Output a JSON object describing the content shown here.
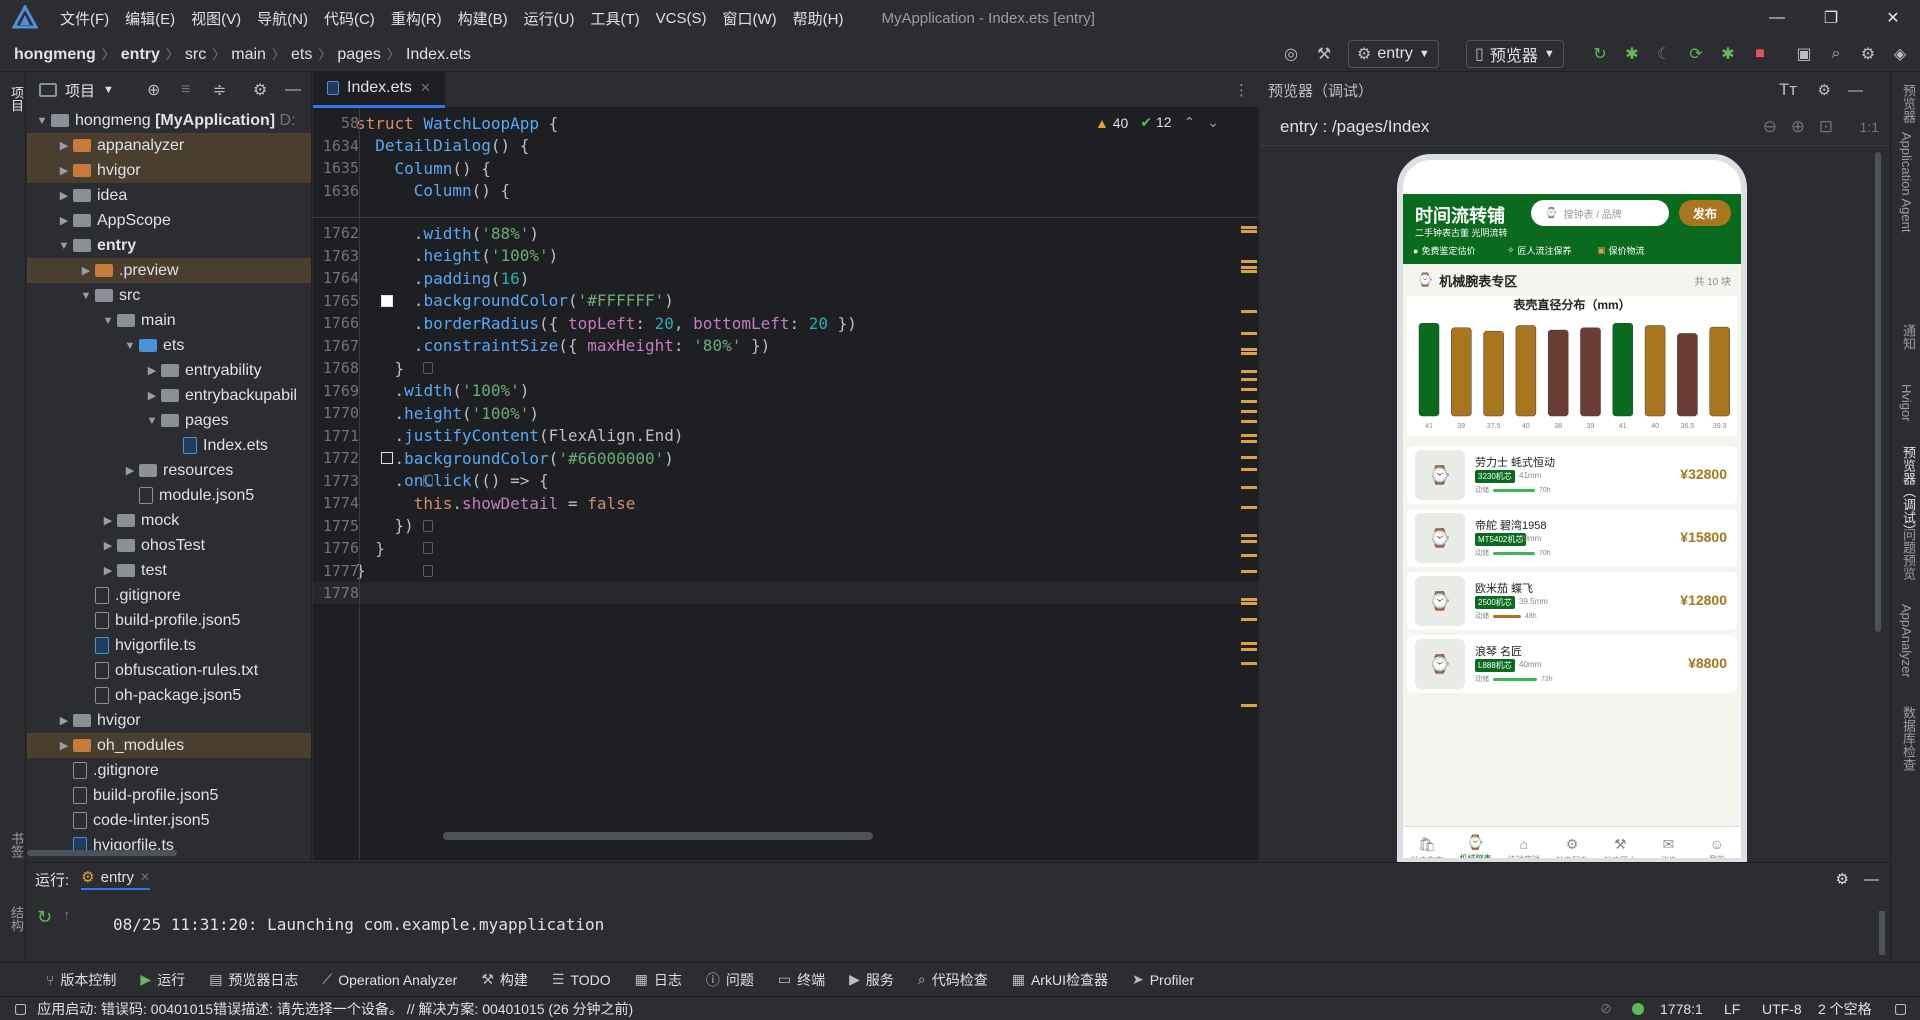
{
  "menubar": {
    "items": [
      "文件(F)",
      "编辑(E)",
      "视图(V)",
      "导航(N)",
      "代码(C)",
      "重构(R)",
      "构建(B)",
      "运行(U)",
      "工具(T)",
      "VCS(S)",
      "窗口(W)",
      "帮助(H)"
    ],
    "window_title": "MyApplication - Index.ets [entry]"
  },
  "breadcrumb": {
    "items": [
      "hongmeng",
      "entry",
      "src",
      "main",
      "ets",
      "pages",
      "Index.ets"
    ]
  },
  "toolbar": {
    "module": "entry",
    "device": "预览器"
  },
  "left_strip": {
    "project": "项目",
    "bookmarks": "书签",
    "structure": "结构"
  },
  "project_panel": {
    "title": "项目",
    "root": "hongmeng",
    "root_module": "[MyApplication]",
    "root_path": "D:",
    "items": [
      {
        "label": "appanalyzer",
        "level": 1,
        "type": "folder-o"
      },
      {
        "label": "hvigor",
        "level": 1,
        "type": "folder-o"
      },
      {
        "label": "idea",
        "level": 1,
        "type": "folder"
      },
      {
        "label": "AppScope",
        "level": 1,
        "type": "folder"
      },
      {
        "label": "entry",
        "level": 1,
        "type": "folder"
      },
      {
        "label": ".preview",
        "level": 2,
        "type": "folder-o"
      },
      {
        "label": "src",
        "level": 2,
        "type": "folder"
      },
      {
        "label": "main",
        "level": 3,
        "type": "folder"
      },
      {
        "label": "ets",
        "level": 4,
        "type": "folder-b"
      },
      {
        "label": "entryability",
        "level": 5,
        "type": "folder"
      },
      {
        "label": "entrybackupabil",
        "level": 5,
        "type": "folder"
      },
      {
        "label": "pages",
        "level": 5,
        "type": "folder"
      },
      {
        "label": "Index.ets",
        "level": 6,
        "type": "file-ts"
      },
      {
        "label": "resources",
        "level": 4,
        "type": "folder"
      },
      {
        "label": "module.json5",
        "level": 4,
        "type": "file"
      },
      {
        "label": "mock",
        "level": 3,
        "type": "folder"
      },
      {
        "label": "ohosTest",
        "level": 3,
        "type": "folder"
      },
      {
        "label": "test",
        "level": 3,
        "type": "folder"
      },
      {
        "label": ".gitignore",
        "level": 2,
        "type": "file"
      },
      {
        "label": "build-profile.json5",
        "level": 2,
        "type": "file"
      },
      {
        "label": "hvigorfile.ts",
        "level": 2,
        "type": "file-ts"
      },
      {
        "label": "obfuscation-rules.txt",
        "level": 2,
        "type": "file"
      },
      {
        "label": "oh-package.json5",
        "level": 2,
        "type": "file"
      },
      {
        "label": "hvigor",
        "level": 1,
        "type": "folder"
      },
      {
        "label": "oh_modules",
        "level": 1,
        "type": "folder-o"
      },
      {
        "label": ".gitignore",
        "level": 1,
        "type": "file"
      },
      {
        "label": "build-profile.json5",
        "level": 1,
        "type": "file"
      },
      {
        "label": "code-linter.json5",
        "level": 1,
        "type": "file"
      },
      {
        "label": "hvigorfile.ts",
        "level": 1,
        "type": "file-ts"
      }
    ]
  },
  "editor": {
    "tab": "Index.ets",
    "warnings": "40",
    "checks": "12",
    "sticky": [
      {
        "ln": "58",
        "code": "struct WatchLoopApp {"
      },
      {
        "ln": "1634",
        "code": "  DetailDialog() {"
      },
      {
        "ln": "1635",
        "code": "    Column() {"
      },
      {
        "ln": "1636",
        "code": "      Column() {"
      }
    ],
    "lines": [
      {
        "ln": "1762",
        "code": "      .width('88%')"
      },
      {
        "ln": "1763",
        "code": "      .height('100%')"
      },
      {
        "ln": "1764",
        "code": "      .padding(16)"
      },
      {
        "ln": "1765",
        "code": "      .backgroundColor('#FFFFFF')"
      },
      {
        "ln": "1766",
        "code": "      .borderRadius({ topLeft: 20, bottomLeft: 20 })"
      },
      {
        "ln": "1767",
        "code": "      .constraintSize({ maxHeight: '80%' })"
      },
      {
        "ln": "1768",
        "code": "    }"
      },
      {
        "ln": "1769",
        "code": "    .width('100%')"
      },
      {
        "ln": "1770",
        "code": "    .height('100%')"
      },
      {
        "ln": "1771",
        "code": "    .justifyContent(FlexAlign.End)"
      },
      {
        "ln": "1772",
        "code": "    .backgroundColor('#66000000')"
      },
      {
        "ln": "1773",
        "code": "    .onClick(() => {"
      },
      {
        "ln": "1774",
        "code": "      this.showDetail = false"
      },
      {
        "ln": "1775",
        "code": "    })"
      },
      {
        "ln": "1776",
        "code": "  }"
      },
      {
        "ln": "1777",
        "code": "}"
      },
      {
        "ln": "1778",
        "code": ""
      }
    ]
  },
  "preview": {
    "title": "预览器（调试）",
    "path": "entry : /pages/Index",
    "zoom": "1:1",
    "app": {
      "logo": "时间流转铺",
      "subtitle": "二手钟表古董 光阴流转",
      "search_placeholder": "搜钟表 / 品牌",
      "publish": "发布",
      "badges": [
        "免费鉴定估价",
        "匠人流注保养",
        "保价物流"
      ],
      "section": "机械腕表专区",
      "count": "共 10 块",
      "chart_title": "表壳直径分布（mm）",
      "cards": [
        {
          "name": "劳力士 蚝式恒动",
          "tag": "3230机芯",
          "size": "41mm",
          "wear": "70h",
          "price": "¥32800"
        },
        {
          "name": "帝舵 碧湾1958",
          "tag": "MT5402机芯",
          "size": "39mm",
          "wear": "70h",
          "price": "¥15800"
        },
        {
          "name": "欧米茄 蝶飞",
          "tag": "2500机芯",
          "size": "39.5mm",
          "wear": "48h",
          "price": "¥12800"
        },
        {
          "name": "浪琴 名匠",
          "tag": "L888机芯",
          "size": "40mm",
          "wear": "72h",
          "price": "¥8800"
        }
      ],
      "wear_label": "动储",
      "tabs": [
        "钟表集市",
        "机械腕表",
        "挂钟座钟",
        "钟表配件",
        "钟表匠人",
        "消息",
        "我的"
      ]
    }
  },
  "chart_data": {
    "type": "bar",
    "title": "表壳直径分布（mm）",
    "categories": [
      "41",
      "39",
      "37.5",
      "40",
      "38",
      "39",
      "41",
      "40",
      "36.5",
      "39.3"
    ],
    "values": [
      41,
      39,
      37.5,
      40,
      38,
      39,
      41,
      40,
      36.5,
      39.3
    ],
    "colors": [
      "#0a6b1e",
      "#a8761e",
      "#a8761e",
      "#a8761e",
      "#6b3e35",
      "#6b3e35",
      "#0a6b1e",
      "#a8761e",
      "#6b3e35",
      "#a8761e"
    ]
  },
  "right_strip": [
    "预览器",
    "Application Agent",
    "通知",
    "Hvigor",
    "预览器（调试）",
    "问题预览",
    "AppAnalyzer",
    "数据库检查"
  ],
  "run": {
    "label": "运行:",
    "config": "entry",
    "log": "08/25 11:31:20: Launching com.example.myapplication"
  },
  "bottom_tools": [
    "版本控制",
    "运行",
    "预览器日志",
    "Operation Analyzer",
    "构建",
    "TODO",
    "日志",
    "问题",
    "终端",
    "服务",
    "代码检查",
    "ArkUI检查器",
    "Profiler"
  ],
  "status": {
    "message": "应用启动: 错误码: 00401015错误描述: 请先选择一个设备。 // 解决方案: 00401015 (26 分钟之前)",
    "position": "1778:1",
    "line_sep": "LF",
    "encoding": "UTF-8",
    "indent": "2 个空格"
  }
}
